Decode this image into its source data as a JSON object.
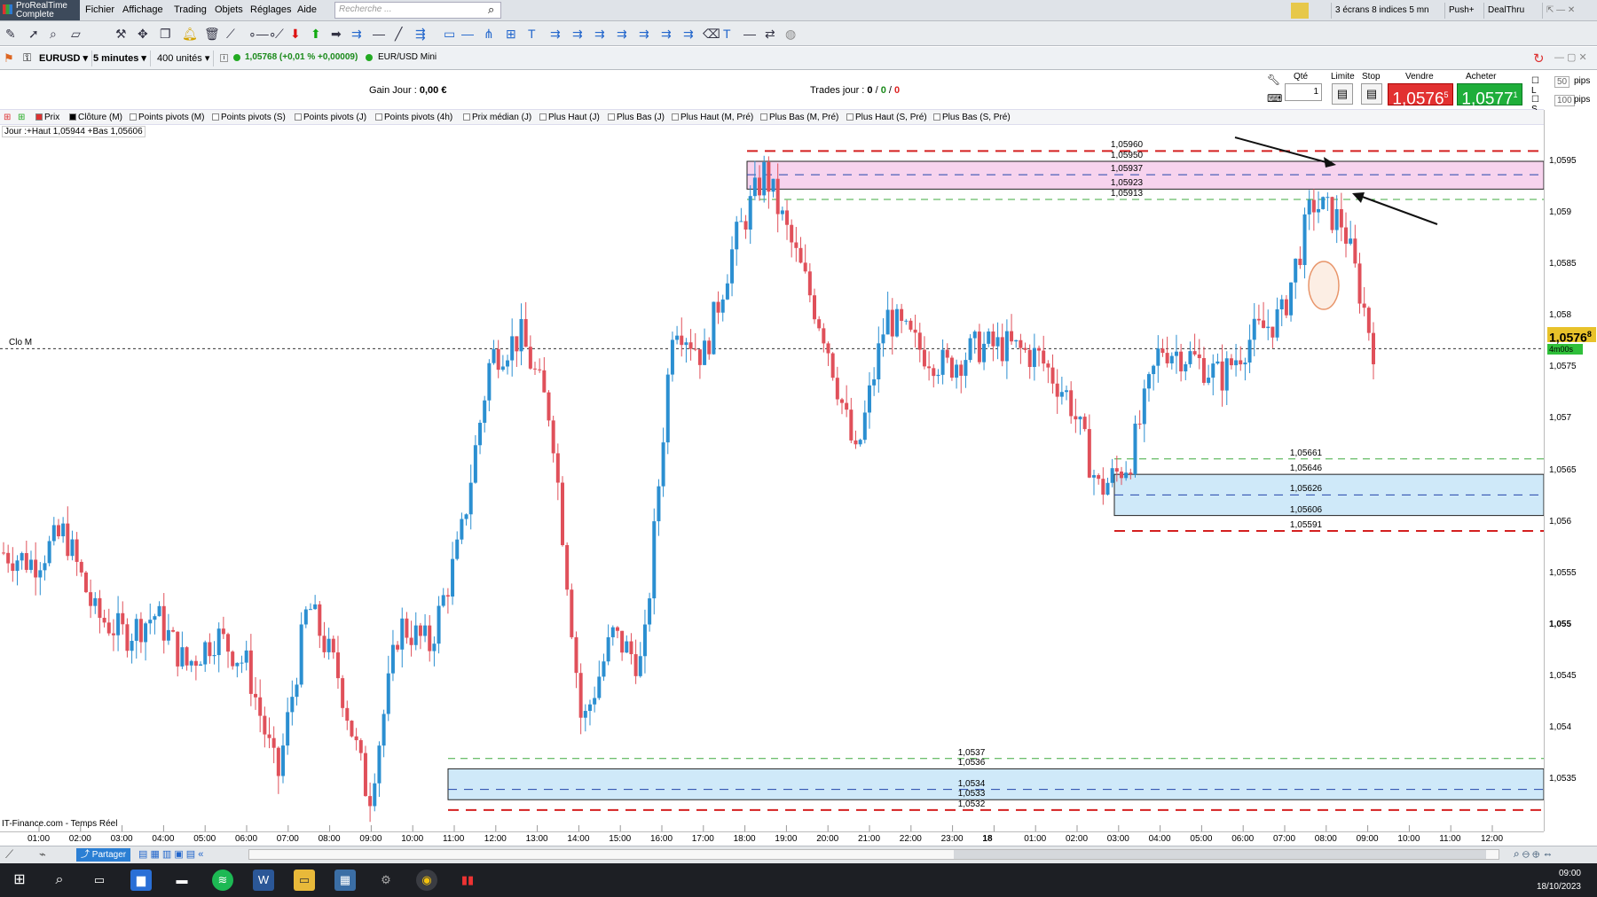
{
  "app": {
    "name": "ProRealTime",
    "edition": "Complete"
  },
  "menu": [
    "Fichier",
    "Affichage",
    "Trading",
    "Objets",
    "Réglages",
    "Aide"
  ],
  "search": {
    "placeholder": "Recherche ..."
  },
  "top_right": {
    "screens": "3 écrans 8 indices 5 mn",
    "push": "Push+",
    "dealthru": "DealThru"
  },
  "instrument": {
    "symbol": "EURUSD",
    "timeframe": "5 minutes",
    "units": "400 unités",
    "quote": "1,05768 (+0,01 % +0,00009)",
    "name": "EUR/USD Mini"
  },
  "trade_bar": {
    "gain_label": "Gain Jour :",
    "gain_value": "0,00 €",
    "trades_label": "Trades jour :",
    "trades_a": "0",
    "trades_b": "0",
    "trades_c": "0",
    "qte_label": "Qté",
    "qte_value": "1",
    "limite_label": "Limite",
    "stop_label": "Stop",
    "vendre_label": "Vendre",
    "acheter_label": "Acheter",
    "sell_price": "1,0576",
    "sell_sup": "5",
    "buy_price": "1,0577",
    "buy_sup": "1",
    "opt_l": "L",
    "opt_s": "S",
    "opt_l_val": "50",
    "opt_s_val": "100",
    "pips": "pips"
  },
  "indicators": [
    "Prix",
    "Clôture (M)",
    "Points pivots (M)",
    "Points pivots (S)",
    "Points pivots (J)",
    "Points pivots (4h)",
    "Prix médian (J)",
    "Plus Haut (J)",
    "Plus Bas (J)",
    "Plus Haut (M, Pré)",
    "Plus Bas (M, Pré)",
    "Plus Haut (S, Pré)",
    "Plus Bas (S, Pré)"
  ],
  "day_info": "Jour :+Haut 1,05944 +Bas 1,05606",
  "close_label": "Clo M",
  "source": "IT-Finance.com - Temps Réel",
  "price_axis": {
    "ticks": [
      "1,0595",
      "1,059",
      "1,0585",
      "1,058",
      "1,0575",
      "1,057",
      "1,0565",
      "1,056",
      "1,0555",
      "1,055",
      "1,0545",
      "1,054",
      "1,0535"
    ],
    "last_price": "1,0576",
    "last_sup": "8",
    "countdown": "4m00s"
  },
  "time_axis": [
    "01:00",
    "02:00",
    "03:00",
    "04:00",
    "05:00",
    "06:00",
    "07:00",
    "08:00",
    "09:00",
    "10:00",
    "11:00",
    "12:00",
    "13:00",
    "14:00",
    "15:00",
    "16:00",
    "17:00",
    "18:00",
    "19:00",
    "20:00",
    "21:00",
    "22:00",
    "23:00",
    "18",
    "01:00",
    "02:00",
    "03:00",
    "04:00",
    "05:00",
    "06:00",
    "07:00",
    "08:00",
    "09:00",
    "10:00",
    "11:00",
    "12:00"
  ],
  "zones": {
    "top": {
      "levels": [
        "1,05960",
        "1,05950",
        "1,05937",
        "1,05923",
        "1,05913"
      ]
    },
    "mid": {
      "levels": [
        "1,05661",
        "1,05646",
        "1,05626",
        "1,05606",
        "1,05591"
      ]
    },
    "low": {
      "levels": [
        "1,0537",
        "1,0536",
        "1,0534",
        "1,0533",
        "1,0532"
      ]
    }
  },
  "colors": {
    "up": "#2b8fd1",
    "down": "#e0505a",
    "zone_pink": "#f7d3ee",
    "zone_blue": "#cfe9f9",
    "red_dash": "#d42020",
    "green_dash": "#3faa3f"
  },
  "chart_data": {
    "type": "candlestick",
    "instrument": "EURUSD",
    "timeframe": "5 minutes",
    "ylim": [
      1.053,
      1.0598
    ],
    "close_line": 1.05768,
    "day_high": 1.05944,
    "day_low": 1.05606,
    "path": [
      {
        "t": "00:00",
        "p": 1.0557
      },
      {
        "t": "01:00",
        "p": 1.0556
      },
      {
        "t": "02:00",
        "p": 1.0559
      },
      {
        "t": "03:00",
        "p": 1.0551
      },
      {
        "t": "04:00",
        "p": 1.0549
      },
      {
        "t": "05:00",
        "p": 1.0551
      },
      {
        "t": "06:00",
        "p": 1.0546
      },
      {
        "t": "07:00",
        "p": 1.0549
      },
      {
        "t": "08:00",
        "p": 1.0546
      },
      {
        "t": "09:00",
        "p": 1.0535
      },
      {
        "t": "09:40",
        "p": 1.0552
      },
      {
        "t": "10:00",
        "p": 1.0545
      },
      {
        "t": "10:50",
        "p": 1.0533
      },
      {
        "t": "11:30",
        "p": 1.055
      },
      {
        "t": "12:00",
        "p": 1.0548
      },
      {
        "t": "12:40",
        "p": 1.0558
      },
      {
        "t": "13:30",
        "p": 1.0576
      },
      {
        "t": "14:00",
        "p": 1.0578
      },
      {
        "t": "14:30",
        "p": 1.057
      },
      {
        "t": "14:50",
        "p": 1.054
      },
      {
        "t": "15:30",
        "p": 1.0549
      },
      {
        "t": "16:00",
        "p": 1.0546
      },
      {
        "t": "16:30",
        "p": 1.058
      },
      {
        "t": "17:00",
        "p": 1.0576
      },
      {
        "t": "17:30",
        "p": 1.0587
      },
      {
        "t": "18:00",
        "p": 1.0594
      },
      {
        "t": "18:30",
        "p": 1.0586
      },
      {
        "t": "19:00",
        "p": 1.0578
      },
      {
        "t": "20:00",
        "p": 1.0566
      },
      {
        "t": "21:00",
        "p": 1.058
      },
      {
        "t": "21:30",
        "p": 1.0577
      },
      {
        "t": "22:00",
        "p": 1.0575
      },
      {
        "t": "23:00",
        "p": 1.0577
      },
      {
        "t": "00:00",
        "p": 1.0577
      },
      {
        "t": "01:00",
        "p": 1.0576
      },
      {
        "t": "02:00",
        "p": 1.0572
      },
      {
        "t": "03:00",
        "p": 1.0563
      },
      {
        "t": "03:30",
        "p": 1.0566
      },
      {
        "t": "04:00",
        "p": 1.0577
      },
      {
        "t": "05:00",
        "p": 1.0576
      },
      {
        "t": "06:00",
        "p": 1.0574
      },
      {
        "t": "07:00",
        "p": 1.0578
      },
      {
        "t": "07:40",
        "p": 1.058
      },
      {
        "t": "08:00",
        "p": 1.0591
      },
      {
        "t": "08:20",
        "p": 1.0589
      },
      {
        "t": "08:50",
        "p": 1.0577
      }
    ]
  },
  "taskbar": {
    "time": "09:00",
    "date": "18/10/2023",
    "partager": "Partager"
  }
}
